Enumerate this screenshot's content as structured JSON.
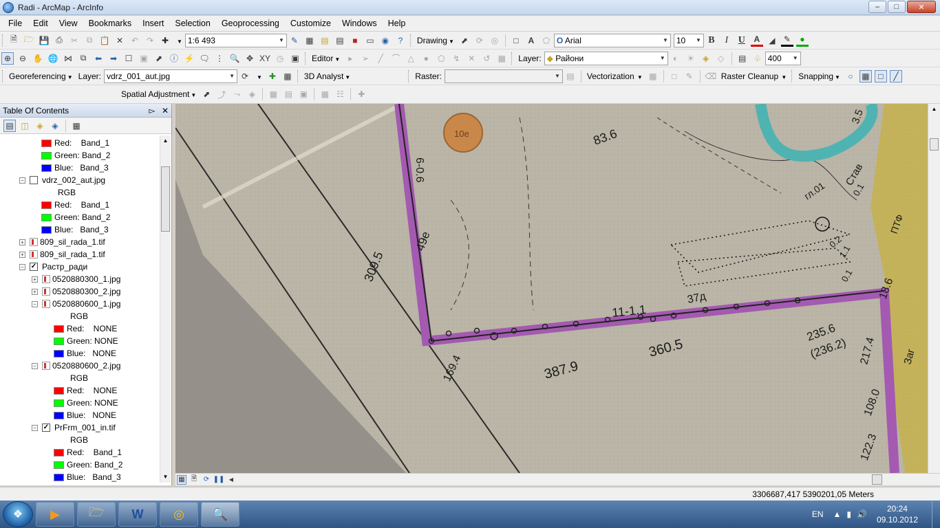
{
  "window": {
    "title": "Radi - ArcMap - ArcInfo",
    "controls": [
      "minimize-icon",
      "maximize-icon",
      "close-icon"
    ]
  },
  "menu": [
    "File",
    "Edit",
    "View",
    "Bookmarks",
    "Insert",
    "Selection",
    "Geoprocessing",
    "Customize",
    "Windows",
    "Help"
  ],
  "standard_toolbar": {
    "scale": "1:6 493",
    "drawing": "Drawing",
    "font": "Arial",
    "font_size": "10",
    "bold": "B",
    "italic": "I",
    "underline": "U"
  },
  "tools_toolbar": {
    "editor": "Editor",
    "layer_label": "Layer:",
    "layer_value": "Райони",
    "zoom_value": "400"
  },
  "georef_toolbar": {
    "georeferencing": "Georeferencing",
    "layer_label": "Layer:",
    "layer_value": "vdrz_001_aut.jpg",
    "analyst": "3D Analyst",
    "raster_label": "Raster:",
    "raster_value": "",
    "vectorization": "Vectorization",
    "raster_cleanup": "Raster Cleanup",
    "snapping": "Snapping"
  },
  "spatial_toolbar": {
    "spatial_adjustment": "Spatial Adjustment"
  },
  "toc": {
    "title": "Table Of Contents",
    "rows": [
      {
        "kind": "band",
        "label": "Red:    Band_1",
        "color": "#ff0000",
        "indent": 60
      },
      {
        "kind": "band",
        "label": "Green: Band_2",
        "color": "#00ff00",
        "indent": 60
      },
      {
        "kind": "band",
        "label": "Blue:   Band_3",
        "color": "#0000ff",
        "indent": 60
      },
      {
        "kind": "layer",
        "label": "vdrz_002_aut.jpg",
        "expander": "−",
        "checked": false,
        "indent": 28
      },
      {
        "kind": "text",
        "label": "RGB",
        "indent": 84
      },
      {
        "kind": "band",
        "label": "Red:    Band_1",
        "color": "#ff0000",
        "indent": 60
      },
      {
        "kind": "band",
        "label": "Green: Band_2",
        "color": "#00ff00",
        "indent": 60
      },
      {
        "kind": "band",
        "label": "Blue:   Band_3",
        "color": "#0000ff",
        "indent": 60
      },
      {
        "kind": "raster",
        "label": "809_sil_rada_1.tif",
        "expander": "+",
        "indent": 28
      },
      {
        "kind": "raster",
        "label": "809_sil_rada_1.tif",
        "expander": "+",
        "indent": 28
      },
      {
        "kind": "layer",
        "label": "Растр_ради",
        "expander": "−",
        "checked": true,
        "indent": 28
      },
      {
        "kind": "raster",
        "label": "0520880300_1.jpg",
        "expander": "+",
        "indent": 46
      },
      {
        "kind": "raster",
        "label": "0520880300_2.jpg",
        "expander": "+",
        "indent": 46
      },
      {
        "kind": "raster",
        "label": "0520880600_1.jpg",
        "expander": "−",
        "indent": 46
      },
      {
        "kind": "text",
        "label": "RGB",
        "indent": 102
      },
      {
        "kind": "band",
        "label": "Red:    NONE",
        "color": "#ff0000",
        "indent": 78
      },
      {
        "kind": "band",
        "label": "Green: NONE",
        "color": "#00ff00",
        "indent": 78
      },
      {
        "kind": "band",
        "label": "Blue:   NONE",
        "color": "#0000ff",
        "indent": 78
      },
      {
        "kind": "raster",
        "label": "0520880600_2.jpg",
        "expander": "−",
        "indent": 46
      },
      {
        "kind": "text",
        "label": "RGB",
        "indent": 102
      },
      {
        "kind": "band",
        "label": "Red:    NONE",
        "color": "#ff0000",
        "indent": 78
      },
      {
        "kind": "band",
        "label": "Green: NONE",
        "color": "#00ff00",
        "indent": 78
      },
      {
        "kind": "band",
        "label": "Blue:   NONE",
        "color": "#0000ff",
        "indent": 78
      },
      {
        "kind": "layer",
        "label": "PrFrm_001_in.tif",
        "expander": "−",
        "checked": true,
        "indent": 46
      },
      {
        "kind": "text",
        "label": "RGB",
        "indent": 102
      },
      {
        "kind": "band",
        "label": "Red:    Band_1",
        "color": "#ff0000",
        "indent": 78
      },
      {
        "kind": "band",
        "label": "Green: Band_2",
        "color": "#00ff00",
        "indent": 78
      },
      {
        "kind": "band",
        "label": "Blue:   Band_3",
        "color": "#0000ff",
        "indent": 78
      }
    ]
  },
  "map_labels": [
    "6-0.6",
    "83.6",
    "49e",
    "309.5",
    "11-1.1",
    "37д",
    "360.5",
    "387.9",
    "169.4",
    "235.6",
    "(236.2)",
    "217.4",
    "108.0",
    "122.3",
    "18.6",
    "ПТФ",
    "Став",
    "3.5",
    "гл.01",
    "0.1",
    "0.2",
    "1.1",
    "0.1",
    "Заг"
  ],
  "map_colors": {
    "paper": "#b9b4a6",
    "boundary": "#a35ab0",
    "water": "#4fb3b2",
    "forest_edge": "#c9b03a",
    "dark_strip": "#95918a"
  },
  "status": {
    "coordinates": "3306687,417  5390201,05 Meters"
  },
  "taskbar": {
    "lang": "EN",
    "time": "20:24",
    "date": "09.10.2012"
  }
}
